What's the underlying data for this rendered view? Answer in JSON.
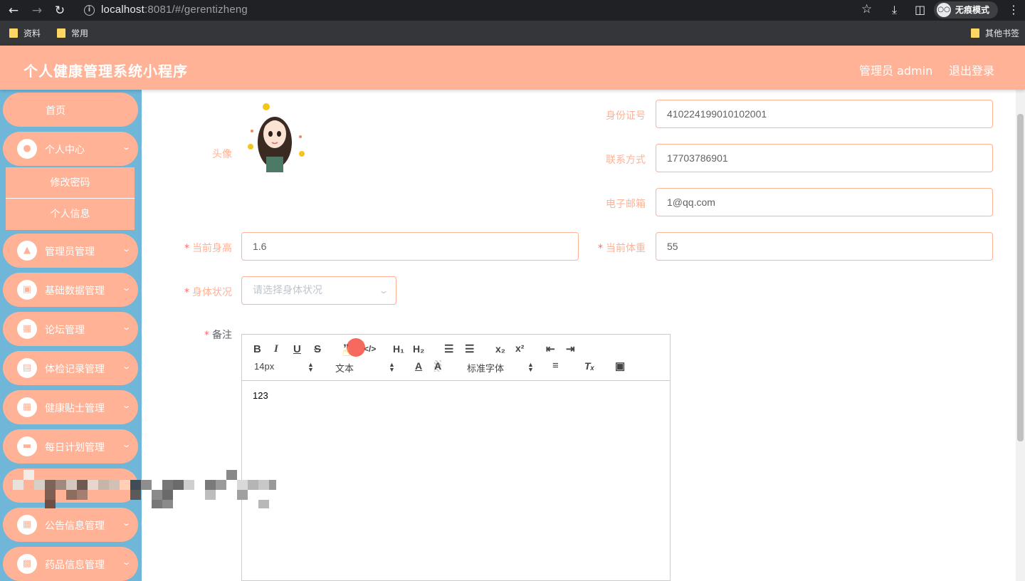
{
  "browser": {
    "url_host": "localhost",
    "url_rest": ":8081/#/gerentizheng",
    "incognito_label": "无痕模式",
    "bookmarks": [
      "资料",
      "常用"
    ],
    "other_bookmarks": "其他书签"
  },
  "header": {
    "title": "个人健康管理系统小程序",
    "user": "管理员 admin",
    "logout": "退出登录"
  },
  "sidebar": {
    "home": "首页",
    "personal_center": "个人中心",
    "sub_items": [
      "修改密码",
      "个人信息"
    ],
    "items": [
      "管理员管理",
      "基础数据管理",
      "论坛管理",
      "体检记录管理",
      "健康贴士管理",
      "每日计划管理",
      "公告信息管理",
      "药品信息管理"
    ]
  },
  "form": {
    "avatar_label": "头像",
    "id_label": "身份证号",
    "id_value": "410224199010102001",
    "phone_label": "联系方式",
    "phone_value": "17703786901",
    "email_label": "电子邮箱",
    "email_value": "1@qq.com",
    "height_label": "当前身高",
    "height_value": "1.6",
    "weight_label": "当前体重",
    "weight_value": "55",
    "status_label": "身体状况",
    "status_placeholder": "请选择身体状况",
    "note_label": "备注",
    "required_mark": "*"
  },
  "editor": {
    "font_size": "14px",
    "text_type": "文本",
    "font_family": "标准字体",
    "content": "123"
  },
  "colors": {
    "accent": "#ffb296",
    "sidebar_bg": "#6fb6d8",
    "required": "#f56c6c"
  }
}
